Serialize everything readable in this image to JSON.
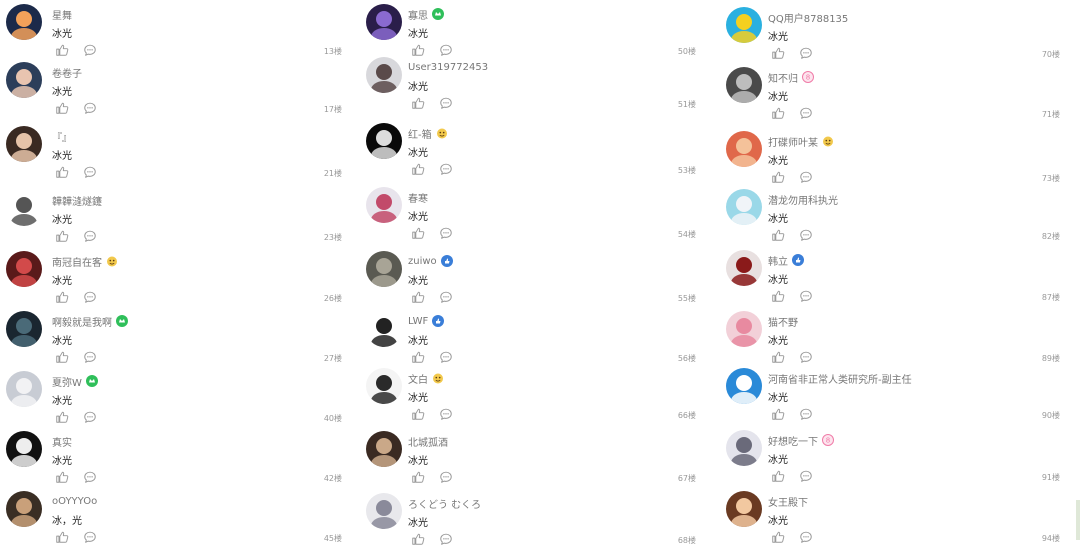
{
  "columns": [
    {
      "comments": [
        {
          "username": "星舞",
          "text": "冰光",
          "floor": "13楼",
          "badge": "",
          "av": [
            "#1c2a4a",
            "#f3a15a"
          ]
        },
        {
          "username": "卷卷子",
          "text": "冰光",
          "floor": "17楼",
          "badge": "",
          "av": [
            "#2c3e5a",
            "#e8c4b0"
          ]
        },
        {
          "username": "『』",
          "text": "冰光",
          "floor": "21楼",
          "badge": "",
          "av": [
            "#3a2a22",
            "#e6c3a8"
          ]
        },
        {
          "username": "韡韡漨燧鑳",
          "text": "冰光",
          "floor": "23楼",
          "badge": "",
          "av": [
            "#ffffff",
            "#555555"
          ]
        },
        {
          "username": "南冠自在客",
          "text": "冰光",
          "floor": "26楼",
          "badge": "emoji",
          "av": [
            "#5a1a1a",
            "#d24a4a"
          ]
        },
        {
          "username": "啊毅就是我啊",
          "text": "冰光",
          "floor": "27楼",
          "badge": "green",
          "av": [
            "#1a2630",
            "#4a6a78"
          ]
        },
        {
          "username": "夏弥W",
          "text": "冰光",
          "floor": "40楼",
          "badge": "green",
          "av": [
            "#c8ccd4",
            "#f2f2f4"
          ]
        },
        {
          "username": "真实",
          "text": "冰光",
          "floor": "42楼",
          "badge": "",
          "av": [
            "#111111",
            "#eeeeee"
          ]
        },
        {
          "username": "oOYYYOo",
          "text": "冰，光",
          "floor": "45楼",
          "badge": "",
          "av": [
            "#3a2e24",
            "#c9a07a"
          ]
        }
      ]
    },
    {
      "comments": [
        {
          "username": "寡思",
          "text": "冰光",
          "floor": "50楼",
          "badge": "green",
          "av": [
            "#2a1e4a",
            "#8a6ad0"
          ]
        },
        {
          "username": "User319772453",
          "text": "冰光",
          "floor": "51楼",
          "badge": "",
          "av": [
            "#d8d8dc",
            "#5a4a4a"
          ]
        },
        {
          "username": "红-箱",
          "text": "冰光",
          "floor": "53楼",
          "badge": "emoji",
          "av": [
            "#0a0a0a",
            "#dddddd"
          ]
        },
        {
          "username": "春寒",
          "text": "冰光",
          "floor": "54楼",
          "badge": "",
          "av": [
            "#e8e4ec",
            "#c24a6a"
          ]
        },
        {
          "username": "zuiwo",
          "text": "冰光",
          "floor": "55楼",
          "badge": "blue",
          "av": [
            "#5a5a52",
            "#a8a496"
          ]
        },
        {
          "username": "LWF",
          "text": "冰光",
          "floor": "56楼",
          "badge": "blue",
          "av": [
            "#ffffff",
            "#222222"
          ]
        },
        {
          "username": "文白",
          "text": "冰光",
          "floor": "66楼",
          "badge": "emoji",
          "av": [
            "#f4f4f4",
            "#2a2a2a"
          ]
        },
        {
          "username": "北城孤酒",
          "text": "冰光",
          "floor": "67楼",
          "badge": "",
          "av": [
            "#3a2a22",
            "#caa888"
          ]
        },
        {
          "username": "ろくどう むくろ",
          "text": "冰光",
          "floor": "68楼",
          "badge": "",
          "av": [
            "#e8e8ec",
            "#8a8a9a"
          ]
        }
      ]
    },
    {
      "comments": [
        {
          "username": "QQ用户8788135",
          "text": "冰光",
          "floor": "70楼",
          "badge": "",
          "av": [
            "#2ab0e0",
            "#f4d020"
          ]
        },
        {
          "username": "知不归",
          "text": "冰光",
          "floor": "71楼",
          "badge": "pink",
          "av": [
            "#4a4a4a",
            "#bdbdbd"
          ]
        },
        {
          "username": "打碟师叶某",
          "text": "冰光",
          "floor": "73楼",
          "badge": "emoji",
          "av": [
            "#e0684a",
            "#f4c29a"
          ]
        },
        {
          "username": "潜龙勿用科执光",
          "text": "冰光",
          "floor": "82楼",
          "badge": "",
          "av": [
            "#9ad8e8",
            "#f0f4f8"
          ]
        },
        {
          "username": "韩立",
          "text": "冰光",
          "floor": "87楼",
          "badge": "blue",
          "av": [
            "#e8e0e0",
            "#8a1a1a"
          ]
        },
        {
          "username": "猫不野",
          "text": "冰光",
          "floor": "89楼",
          "badge": "",
          "av": [
            "#f2d0d8",
            "#e88aa0"
          ]
        },
        {
          "username": "河南省非正常人类研究所-副主任",
          "text": "冰光",
          "floor": "90楼",
          "badge": "",
          "av": [
            "#2a8ad8",
            "#ffffff"
          ]
        },
        {
          "username": "好想吃一下",
          "text": "冰光",
          "floor": "91楼",
          "badge": "pink",
          "av": [
            "#e4e4ec",
            "#6a6a7a"
          ]
        },
        {
          "username": "女王殿下",
          "text": "冰光",
          "floor": "94楼",
          "badge": "",
          "av": [
            "#6a3a22",
            "#f2c8a0"
          ]
        }
      ]
    }
  ],
  "icons": {
    "like": "thumbs-up-icon",
    "reply": "comment-bubble-icon"
  },
  "colors": {
    "username": "#777777",
    "text": "#222222",
    "floor": "#999999",
    "icon": "#999999",
    "green_badge": "#2fbf5a",
    "blue_badge": "#3a7ed8",
    "pink_badge": "#f07ca8"
  }
}
